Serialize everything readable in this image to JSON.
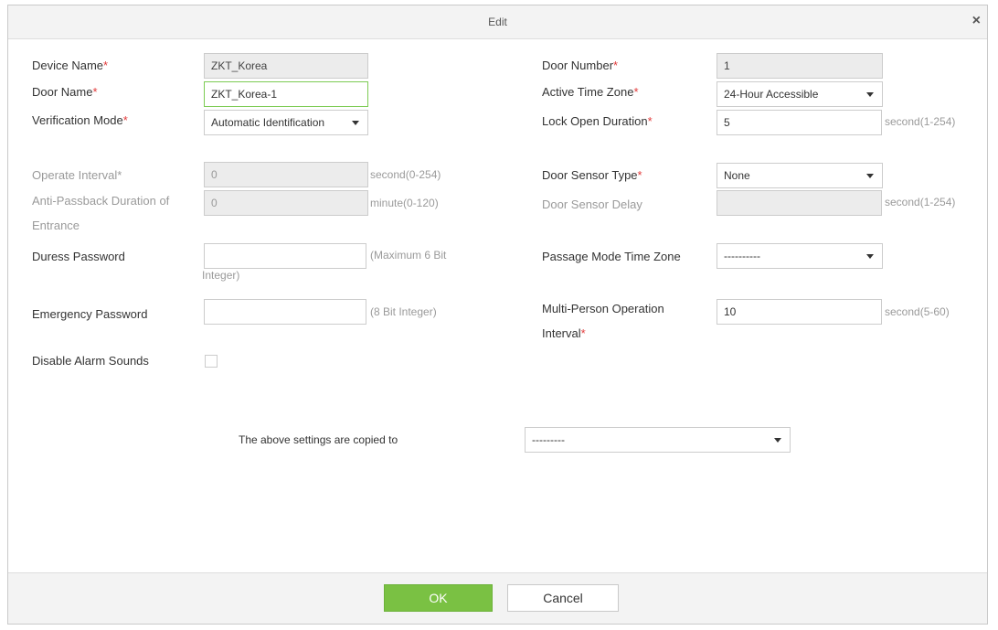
{
  "dialog": {
    "title": "Edit",
    "close_glyph": "×"
  },
  "left": {
    "device_name": {
      "label": "Device Name",
      "value": "ZKT_Korea"
    },
    "door_name": {
      "label": "Door Name",
      "value": "ZKT_Korea-1"
    },
    "verification_mode": {
      "label": "Verification Mode",
      "value": "Automatic Identification"
    },
    "operate_interval": {
      "label": "Operate Interval",
      "value": "0",
      "hint": "second(0-254)"
    },
    "anti_passback": {
      "label": "Anti-Passback Duration of Entrance",
      "value": "0",
      "hint": "minute(0-120)"
    },
    "duress_password": {
      "label": "Duress Password",
      "value": "",
      "hint": "(Maximum 6 Bit Integer)"
    },
    "emergency_password": {
      "label": "Emergency Password",
      "value": "",
      "hint": "(8 Bit Integer)"
    },
    "disable_alarm": {
      "label": "Disable Alarm Sounds",
      "checked": false
    }
  },
  "right": {
    "door_number": {
      "label": "Door Number",
      "value": "1"
    },
    "active_time_zone": {
      "label": "Active Time Zone",
      "value": "24-Hour Accessible"
    },
    "lock_open_duration": {
      "label": "Lock Open Duration",
      "value": "5",
      "hint": "second(1-254)"
    },
    "door_sensor_type": {
      "label": "Door Sensor Type",
      "value": "None"
    },
    "door_sensor_delay": {
      "label": "Door Sensor Delay",
      "value": "",
      "hint": "second(1-254)"
    },
    "passage_mode_tz": {
      "label": "Passage Mode Time Zone",
      "value": "----------"
    },
    "multi_person_interval": {
      "label": "Multi-Person Operation Interval",
      "value": "10",
      "hint": "second(5-60)"
    }
  },
  "copy": {
    "label": "The above settings are copied to",
    "value": "---------"
  },
  "required_mark": "*",
  "buttons": {
    "ok": "OK",
    "cancel": "Cancel"
  },
  "colors": {
    "ok_button": "#7ac143",
    "required": "#e23b3b",
    "readonly_bg": "#ececec"
  }
}
